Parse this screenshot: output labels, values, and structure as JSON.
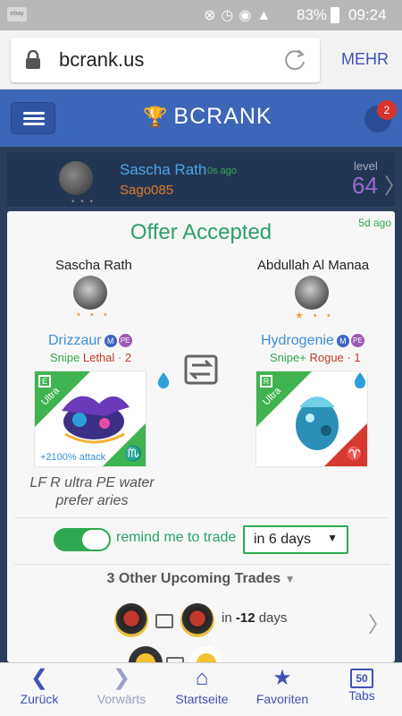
{
  "status_bar": {
    "battery": "83%",
    "time": "09:24"
  },
  "browser": {
    "url": "bcrank.us",
    "menu_label": "MEHR"
  },
  "header": {
    "logo_text": "BCRANK",
    "notification_count": "2"
  },
  "user_row": {
    "name": "Sascha Rath",
    "ago": "0s ago",
    "handle": "Sago085",
    "level_label": "level",
    "level": "64"
  },
  "offer": {
    "ago": "5d ago",
    "title": "Offer Accepted",
    "left": {
      "player": "Sascha Rath",
      "dragon": "Drizzaur",
      "badge_m": "M",
      "badge_pe": "PE",
      "stat1": "Snipe",
      "stat2": "Lethal",
      "stat3": "2",
      "ultra_label": "Ultra",
      "rarity": "E",
      "attack": "+2100% attack",
      "zodiac": "♏"
    },
    "right": {
      "player": "Abdullah Al Manaa",
      "dragon": "Hydrogenie",
      "badge_m": "M",
      "badge_pe": "PE",
      "stat1": "Snipe+",
      "stat2": "Rogue",
      "stat3": "1",
      "ultra_label": "Ultra",
      "rarity": "R",
      "zodiac": "♈"
    },
    "note": "LF R ultra PE water prefer aries"
  },
  "reminder": {
    "label": "remind me to trade",
    "select_value": "in 6 days",
    "enabled": true
  },
  "upcoming": {
    "title": "3 Other Upcoming Trades",
    "trades": [
      {
        "prefix": "in",
        "days": "-12",
        "suffix": "days"
      }
    ]
  },
  "bottom_nav": {
    "back": "Zurück",
    "forward": "Vorwärts",
    "home": "Startseite",
    "favorites": "Favoriten",
    "tabs": "Tabs",
    "tabs_count": "50"
  },
  "colors": {
    "accent_green": "#2fa84f",
    "header_blue": "#3c66b8",
    "link_blue": "#3a8fd8"
  }
}
